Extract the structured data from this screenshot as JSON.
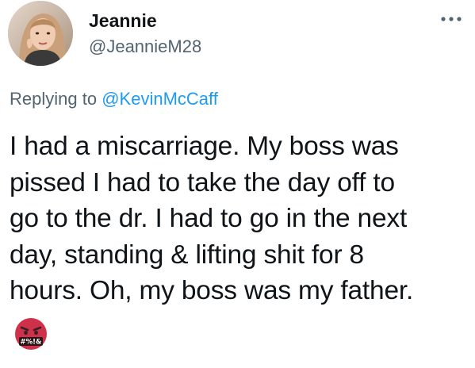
{
  "tweet": {
    "author": {
      "display_name": "Jeannie",
      "handle": "@JeannieM28",
      "avatar_icon": "avatar-photo"
    },
    "more_icon": "more-horizontal-icon",
    "replying": {
      "prefix": "Replying to",
      "mention": "@KevinMcCaff"
    },
    "text_lines": [
      "I had a miscarriage. My boss was",
      "pissed I had to take the day off to",
      "go to the dr. I had to go in the next",
      "day, standing & lifting shit for 8",
      "hours. Oh, my boss was my father."
    ],
    "emoji": {
      "name": "face-with-symbols-on-mouth-icon",
      "symbols": "#%!&"
    },
    "colors": {
      "link": "#1d9bf0",
      "secondary_text": "#536471",
      "primary_text": "#0f1419",
      "emoji_face": "#d0314a"
    }
  }
}
